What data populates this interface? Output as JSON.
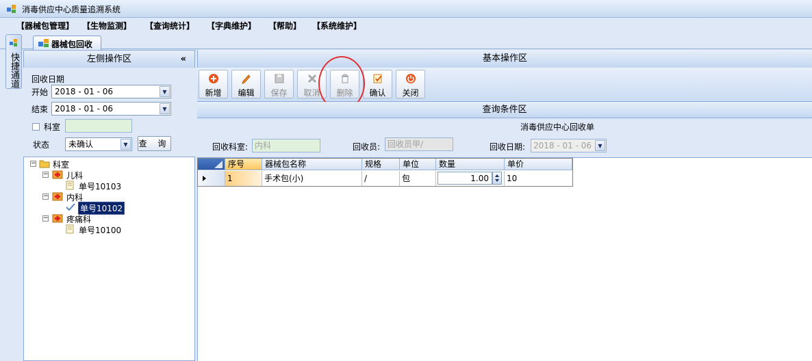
{
  "window": {
    "title": "消毒供应中心质量追溯系统"
  },
  "menu": [
    "【器械包管理】",
    "【生物监测】",
    "【查询统计】",
    "【字典维护】",
    "【帮助】",
    "【系统维护】"
  ],
  "sidebar_strip": {
    "label": "快捷通道"
  },
  "tab": {
    "label": "器械包回收"
  },
  "left_panel": {
    "header": "左侧操作区",
    "collapse": "«",
    "date_group_label": "回收日期",
    "start_label": "开始",
    "start_value": "2018 - 01 - 06",
    "end_label": "结束",
    "end_value": "2018 - 01 - 06",
    "dept_label": "科室",
    "status_label": "状态",
    "status_value": "未确认",
    "query_button": "查 询"
  },
  "tree": {
    "root": "科室",
    "depts": [
      {
        "name": "儿科",
        "items": [
          "单号10103"
        ]
      },
      {
        "name": "内科",
        "items": [
          "单号10102"
        ]
      },
      {
        "name": "疼痛科",
        "items": [
          "单号10100"
        ]
      }
    ]
  },
  "right_panel": {
    "header": "基本操作区",
    "condition_header": "查询条件区",
    "form_title": "消毒供应中心回收单",
    "dept_label": "回收科室:",
    "dept_value": "内科",
    "recycler_label": "回收员:",
    "recycler_value": "回收员甲/",
    "date_label": "回收日期:",
    "date_value": "2018 - 01 - 06"
  },
  "toolbar": {
    "new": "新增",
    "edit": "编辑",
    "save": "保存",
    "cancel": "取消",
    "delete": "删除",
    "confirm": "确认",
    "close": "关闭"
  },
  "grid": {
    "columns": [
      "序号",
      "器械包名称",
      "规格",
      "单位",
      "数量",
      "单价"
    ],
    "rows": [
      {
        "seq": "1",
        "name": "手术包(小)",
        "spec": "/",
        "unit": "包",
        "qty": "1.00",
        "price": "10"
      }
    ]
  },
  "colors": {
    "accent": "#dfe8f6",
    "highlight": "#e03030",
    "selected": "#0a246a"
  }
}
